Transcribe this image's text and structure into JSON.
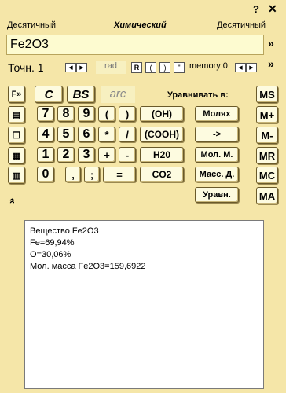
{
  "titlebar": {
    "left_mode": "Десятичный",
    "center_title": "Химический",
    "right_mode": "Десятичный",
    "help_icon": "question-icon",
    "close_icon": "close-icon"
  },
  "display": {
    "value": "Fe2O3"
  },
  "row2": {
    "precision_label": "Точн. 1",
    "rad_label": "rad",
    "r_label": "R",
    "paren_open": "(",
    "paren_close": ")",
    "quote_label": "\"",
    "memory_label": "memory 0"
  },
  "keys": {
    "c": "C",
    "bs": "BS",
    "arc": "arc",
    "oh": "(OH)",
    "equalize_label": "Уравнивать в:",
    "n7": "7",
    "n8": "8",
    "n9": "9",
    "lp": "(",
    "rp": ")",
    "cooh": "(COOH)",
    "moles": "Молях",
    "n4": "4",
    "n5": "5",
    "n6": "6",
    "mul": "*",
    "div": "/",
    "arrow": "->",
    "n1": "1",
    "n2": "2",
    "n3": "3",
    "plus": "+",
    "minus": "-",
    "h2o": "H20",
    "molm": "Мол. М.",
    "n0": "0",
    "comma": ",",
    "semi": ";",
    "eq": "=",
    "co2": "CO2",
    "massd": "Масс. Д.",
    "eqbtn": "Уравн.",
    "ms": "MS",
    "mplus": "M+",
    "mminus": "M-",
    "mr": "MR",
    "mc": "MC",
    "ma": "MA"
  },
  "result": {
    "lines": [
      "Вещество Fe2O3",
      "Fe=69,94%",
      "O=30,06%",
      "Мол. масса Fe2O3=159,6922"
    ]
  }
}
